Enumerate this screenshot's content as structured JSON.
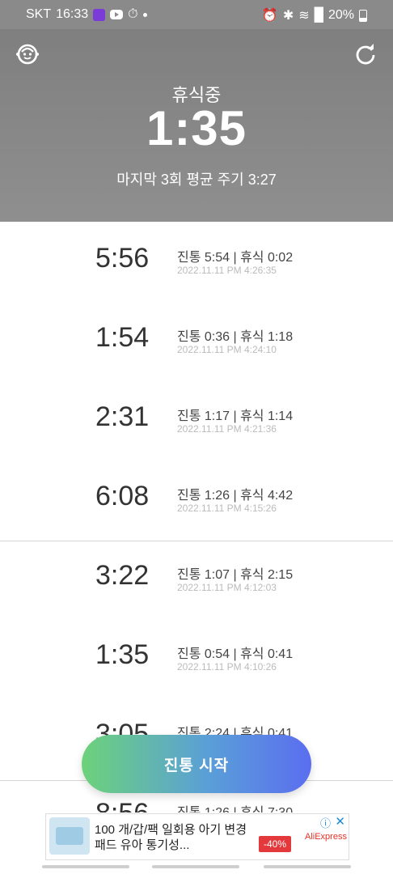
{
  "status_bar": {
    "carrier": "SKT",
    "time": "16:33",
    "battery": "20%"
  },
  "header": {
    "state_label": "휴식중",
    "elapsed": "1:35",
    "average_text": "마지막 3회 평균 주기 3:27"
  },
  "records": [
    {
      "interval": "5:56",
      "detail": "진통 5:54 | 휴식 0:02",
      "stamp": "2022.11.11 PM 4:26:35"
    },
    {
      "interval": "1:54",
      "detail": "진통 0:36 | 휴식 1:18",
      "stamp": "2022.11.11 PM 4:24:10"
    },
    {
      "interval": "2:31",
      "detail": "진통 1:17 | 휴식 1:14",
      "stamp": "2022.11.11 PM 4:21:36"
    },
    {
      "interval": "6:08",
      "detail": "진통 1:26 | 휴식 4:42",
      "stamp": "2022.11.11 PM 4:15:26"
    },
    {
      "interval": "3:22",
      "detail": "진통 1:07 | 휴식 2:15",
      "stamp": "2022.11.11 PM 4:12:03"
    },
    {
      "interval": "1:35",
      "detail": "진통 0:54 | 휴식 0:41",
      "stamp": "2022.11.11 PM 4:10:26"
    },
    {
      "interval": "3:05",
      "detail": "진통 2:24 | 휴식 0:41",
      "stamp": ""
    },
    {
      "interval": "8:56",
      "detail": "진통 1:26 | 휴식 7:30",
      "stamp": ""
    }
  ],
  "start_button_label": "진통 시작",
  "ad": {
    "title": "100 개/갑/팩 일회용 아기 변경 패드 유아 통기성...",
    "discount": "-40%",
    "brand": "AliExpress"
  },
  "colors": {
    "header_bg": "#8a8a8a",
    "button_start": "#6cd27a",
    "button_end": "#5b6ef0"
  }
}
